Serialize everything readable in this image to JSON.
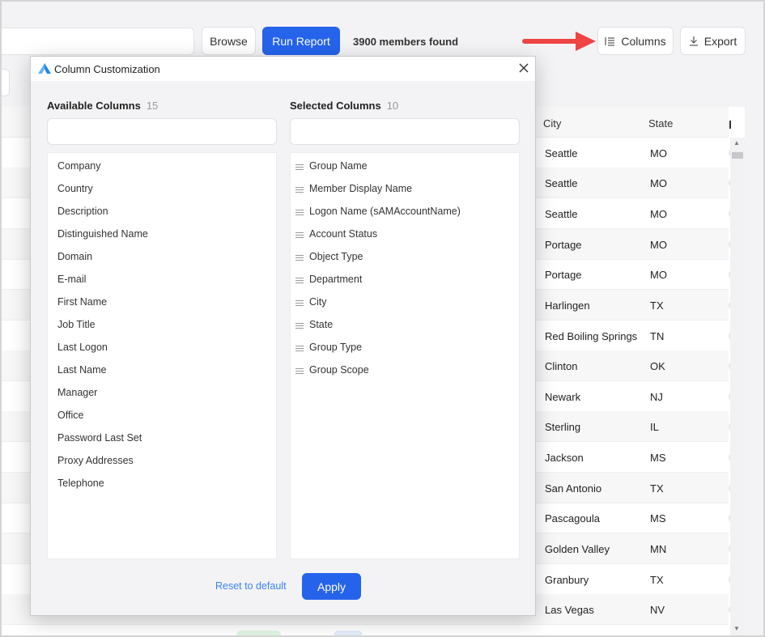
{
  "toolbar": {
    "search_value": "",
    "browse_label": "Browse",
    "run_report_label": "Run Report",
    "members_found": "3900 members found",
    "columns_label": "Columns",
    "export_label": "Export"
  },
  "table": {
    "headers": {
      "city": "City",
      "state": "State"
    },
    "rows": [
      {
        "city": "Seattle",
        "state": "MO"
      },
      {
        "city": "Seattle",
        "state": "MO"
      },
      {
        "city": "Seattle",
        "state": "MO"
      },
      {
        "city": "Portage",
        "state": "MO"
      },
      {
        "city": "Portage",
        "state": "MO"
      },
      {
        "city": "Harlingen",
        "state": "TX"
      },
      {
        "city": "Red Boiling Springs",
        "state": "TN"
      },
      {
        "city": "Clinton",
        "state": "OK"
      },
      {
        "city": "Newark",
        "state": "NJ"
      },
      {
        "city": "Sterling",
        "state": "IL"
      },
      {
        "city": "Jackson",
        "state": "MS"
      },
      {
        "city": "San Antonio",
        "state": "TX"
      },
      {
        "city": "Pascagoula",
        "state": "MS"
      },
      {
        "city": "Golden Valley",
        "state": "MN"
      },
      {
        "city": "Granbury",
        "state": "TX"
      },
      {
        "city": "Las Vegas",
        "state": "NV"
      }
    ]
  },
  "modal": {
    "title": "Column Customization",
    "available": {
      "heading": "Available Columns",
      "count": "15",
      "filter_value": "",
      "items": [
        "Company",
        "Country",
        "Description",
        "Distinguished Name",
        "Domain",
        "E-mail",
        "First Name",
        "Job Title",
        "Last Logon",
        "Last Name",
        "Manager",
        "Office",
        "Password Last Set",
        "Proxy Addresses",
        "Telephone"
      ]
    },
    "selected": {
      "heading": "Selected Columns",
      "count": "10",
      "filter_value": "",
      "items": [
        "Group Name",
        "Member Display Name",
        "Logon Name (sAMAccountName)",
        "Account Status",
        "Object Type",
        "Department",
        "City",
        "State",
        "Group Type",
        "Group Scope"
      ]
    },
    "reset_label": "Reset to default",
    "apply_label": "Apply"
  },
  "colors": {
    "primary": "#2563eb",
    "link": "#3b82f6",
    "arrow": "#ef4444"
  },
  "icons": {
    "columns": "list-columns-icon",
    "export": "download-icon",
    "close": "close-icon",
    "logo": "app-logo-icon",
    "drag": "drag-handle-icon"
  }
}
